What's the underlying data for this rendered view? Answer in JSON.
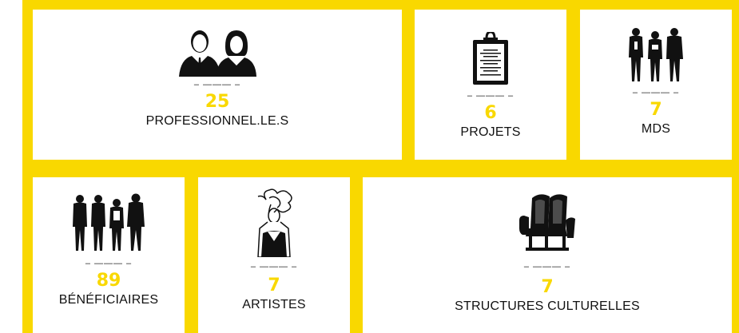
{
  "colors": {
    "accent": "#f9d800",
    "card": "#ffffff",
    "text": "#111111"
  },
  "separator": "– ——— –",
  "stats": [
    {
      "number": "25",
      "label": "PROFESSIONNEL.LE.S",
      "icon": "professionals-icon"
    },
    {
      "number": "6",
      "label": "PROJETS",
      "icon": "clipboard-icon"
    },
    {
      "number": "7",
      "label": "MDS",
      "icon": "group-people-icon"
    },
    {
      "number": "89",
      "label": "BÉNÉFICIAIRES",
      "icon": "beneficiaries-icon"
    },
    {
      "number": "7",
      "label": "ARTISTES",
      "icon": "artist-icon"
    },
    {
      "number": "7",
      "label": "STRUCTURES CULTURELLES",
      "icon": "theater-seats-icon"
    }
  ]
}
